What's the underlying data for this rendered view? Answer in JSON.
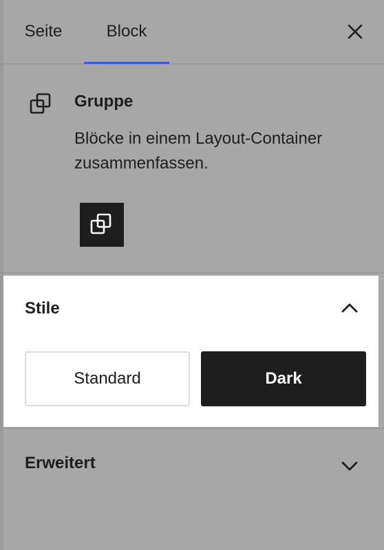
{
  "tabs": {
    "page_label": "Seite",
    "block_label": "Block",
    "active": "Block"
  },
  "block": {
    "title": "Gruppe",
    "description": "Blöcke in einem Layout-Container zusammenfassen.",
    "icon": "group-icon"
  },
  "styles": {
    "title": "Stile",
    "expanded": true,
    "options": [
      {
        "label": "Standard",
        "selected": false
      },
      {
        "label": "Dark",
        "selected": true
      }
    ]
  },
  "advanced": {
    "title": "Erweitert",
    "expanded": false
  },
  "colors": {
    "panel_bg": "#a7a7a7",
    "highlight_bg": "#ffffff",
    "text": "#1e1e1e",
    "tab_indicator": "#3858e9",
    "selected_style_bg": "#1e1e1e"
  }
}
